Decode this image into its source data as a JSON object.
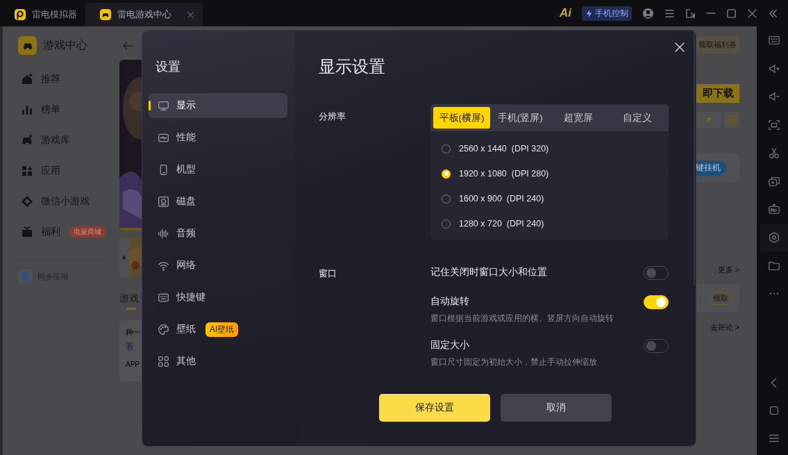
{
  "titlebar": {
    "tabs": [
      {
        "label": "雷电模拟器",
        "selected": false
      },
      {
        "label": "雷电游戏中心",
        "selected": true
      }
    ],
    "ai_label": "Ai",
    "phone_control": "手机控制"
  },
  "game_center": {
    "title": "游戏中心",
    "nav": [
      {
        "label": "推荐"
      },
      {
        "label": "榜单"
      },
      {
        "label": "游戏库"
      },
      {
        "label": "应用"
      },
      {
        "label": "微信小游戏"
      },
      {
        "label": "福利",
        "badge": "电量商城"
      }
    ],
    "sync": "同步应用",
    "content_left": {
      "section_title": "游戏",
      "card_lines": [
        "种一",
        "看",
        "APP"
      ]
    },
    "content_right": {
      "coupon": "领取福利券",
      "download": "即下载",
      "hangup": "键挂机",
      "more": "更多 >",
      "claim": "领取",
      "review": "去评论 >"
    }
  },
  "dialog": {
    "title": "设置",
    "nav": [
      {
        "label": "显示",
        "selected": true
      },
      {
        "label": "性能",
        "selected": false
      },
      {
        "label": "机型",
        "selected": false
      },
      {
        "label": "磁盘",
        "selected": false
      },
      {
        "label": "音频",
        "selected": false
      },
      {
        "label": "网络",
        "selected": false
      },
      {
        "label": "快捷键",
        "selected": false
      },
      {
        "label": "壁纸",
        "selected": false,
        "badge": "AI壁纸"
      },
      {
        "label": "其他",
        "selected": false
      }
    ],
    "heading": "显示设置",
    "resolution": {
      "label": "分辨率",
      "tabs": [
        {
          "label": "平板(横屏)",
          "selected": true
        },
        {
          "label": "手机(竖屏)",
          "selected": false
        },
        {
          "label": "超宽屏",
          "selected": false
        },
        {
          "label": "自定义",
          "selected": false
        }
      ],
      "options": [
        {
          "label": "2560 x 1440  (DPI 320)",
          "selected": false
        },
        {
          "label": "1920 x 1080  (DPI 280)",
          "selected": true
        },
        {
          "label": "1600 x 900  (DPI 240)",
          "selected": false
        },
        {
          "label": "1280 x 720  (DPI 240)",
          "selected": false
        }
      ]
    },
    "window": {
      "label": "窗口",
      "settings": [
        {
          "title": "记住关闭时窗口大小和位置",
          "on": false
        },
        {
          "title": "自动旋转",
          "description": "窗口根据当前游戏或应用的横、竖屏方向自动旋转",
          "on": true
        },
        {
          "title": "固定大小",
          "description": "窗口尺寸固定为初始大小，禁止手动拉伸缩放",
          "on": false
        }
      ]
    },
    "buttons": {
      "save": "保存设置",
      "cancel": "取消"
    }
  }
}
